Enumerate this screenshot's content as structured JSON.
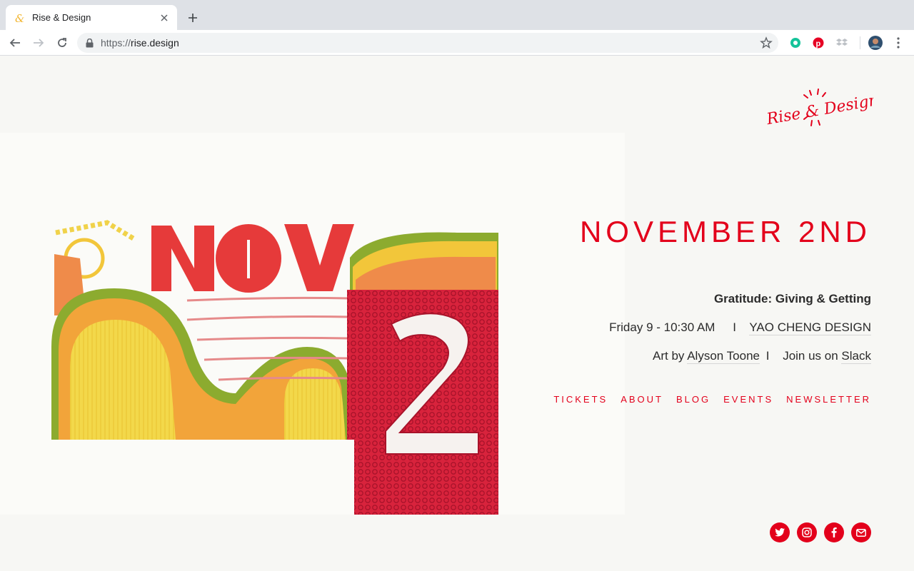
{
  "browser": {
    "tab_title": "Rise & Design",
    "url_scheme": "https://",
    "url_host": "rise.design"
  },
  "page": {
    "logo_text": "Rise & Design",
    "date_heading": "NOVEMBER 2ND",
    "event_title": "Gratitude: Giving & Getting",
    "time_text": "Friday 9 - 10:30 AM",
    "separator": "I",
    "host_link": "YAO CHENG DESIGN",
    "art_by_prefix": "Art by",
    "artist_link": "Alyson Toone",
    "join_text": "Join us on",
    "slack_link": "Slack",
    "nav": [
      "TICKETS",
      "ABOUT",
      "BLOG",
      "EVENTS",
      "NEWSLETTER"
    ],
    "social": [
      "twitter-icon",
      "instagram-icon",
      "facebook-icon",
      "mail-icon"
    ]
  },
  "colors": {
    "accent": "#e3001b",
    "page_bg": "#f7f7f4",
    "text": "#2b2b2b"
  }
}
